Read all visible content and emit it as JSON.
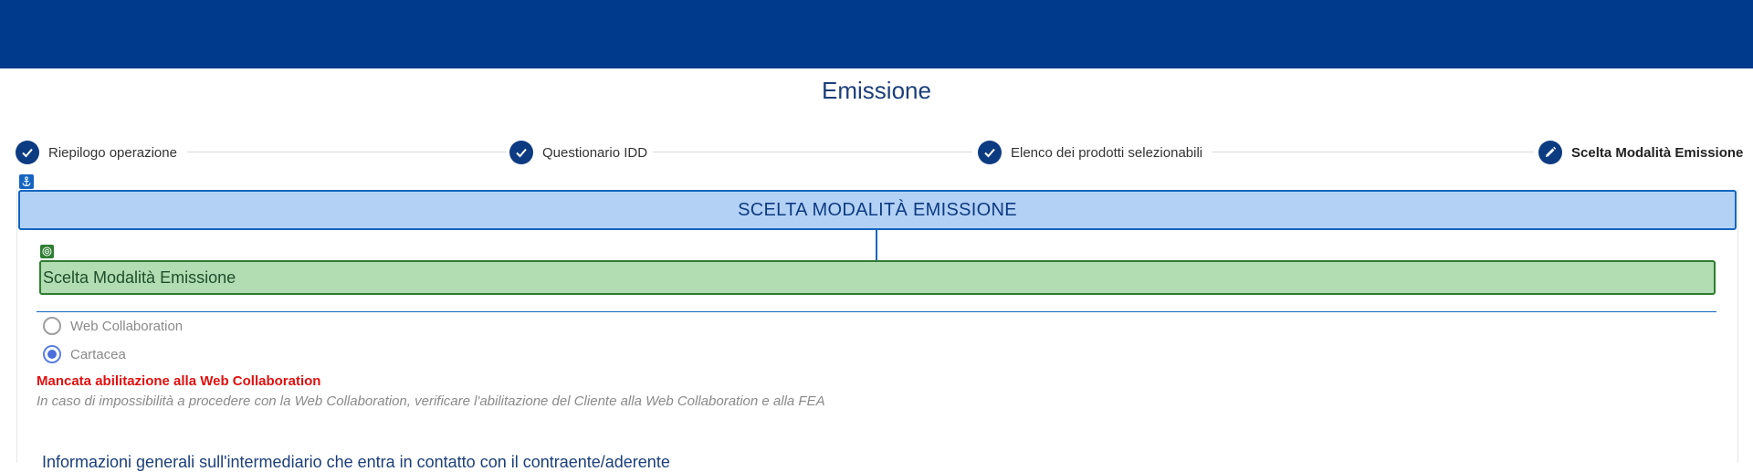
{
  "page": {
    "title": "Emissione"
  },
  "stepper": {
    "steps": [
      {
        "label": "Riepilogo operazione",
        "status": "done",
        "icon": "check-icon"
      },
      {
        "label": "Questionario IDD",
        "status": "done",
        "icon": "check-icon"
      },
      {
        "label": "Elenco dei prodotti selezionabili",
        "status": "done",
        "icon": "check-icon"
      },
      {
        "label": "Scelta Modalità Emissione",
        "status": "active",
        "icon": "pencil-icon"
      }
    ]
  },
  "section": {
    "anchor_icon": "anchor-icon",
    "title": "SCELTA MODALITÀ EMISSIONE"
  },
  "group": {
    "target_icon": "target-icon",
    "title": "Scelta Modalità Emissione",
    "options": [
      {
        "label": "Web Collaboration",
        "checked": false
      },
      {
        "label": "Cartacea",
        "checked": true
      }
    ],
    "warning": "Mancata abilitazione alla Web Collaboration",
    "note": "In caso di impossibilità a procedere con la Web Collaboration, verificare l'abilitazione del Cliente alla Web Collaboration e alla FEA"
  },
  "next_section": {
    "title": "Informazioni generali sull'intermediario che entra in contatto con il contraente/aderente"
  },
  "colors": {
    "topbar": "#003a8c",
    "step_circle": "#0d3b82",
    "section_fill": "#b3d1f5",
    "section_border": "#1565c0",
    "group_fill": "#b2dcb2",
    "group_border": "#2e7d32",
    "warning": "#e01010"
  }
}
